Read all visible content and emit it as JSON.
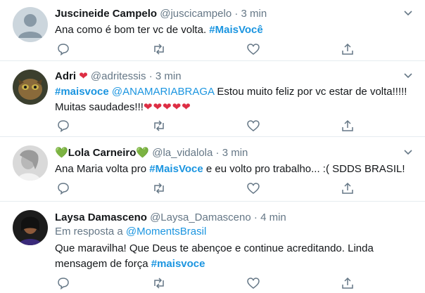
{
  "tweets": [
    {
      "name": "Juscineide Campelo",
      "handle": "@juscicampelo",
      "sep": "·",
      "time": "3 min",
      "text": "Ana como é bom ter vc de volta.",
      "hashtag": "#MaisVocê"
    },
    {
      "name": "Adri",
      "name_emoji": "❤",
      "handle": "@adritessis",
      "sep": "·",
      "time": "3 min",
      "hashtag": "#maisvoce",
      "mention": "@ANAMARIABRAGA",
      "text": "Estou muito feliz por vc estar de volta!!!!! Muitas saudades!!!",
      "hearts": "❤❤❤❤❤"
    },
    {
      "name_prefix": "💚",
      "name": "Lola Carneiro",
      "name_suffix": "💚",
      "handle": "@la_vidalola",
      "sep": "·",
      "time": "3 min",
      "text_before": "Ana Maria volta pro",
      "hashtag": "#MaisVoce",
      "text_after": "e eu volto pro trabalho... :( SDDS BRASIL!"
    },
    {
      "name": "Laysa Damasceno",
      "handle": "@Laysa_Damasceno",
      "sep": "·",
      "time": "4 min",
      "reply_label": "Em resposta a",
      "reply_to": "@MomentsBrasil",
      "text": "Que maravilha! Que Deus te abençoe e continue acreditando. Linda mensagem de força",
      "hashtag": "#maisvoce"
    }
  ],
  "colors": {
    "text": "#14171a",
    "muted": "#657786",
    "link": "#1b95e0",
    "heart": "#dd2e44",
    "green_heart": "#78b159",
    "divider": "#e6ecf0"
  },
  "icons": [
    "reply-icon",
    "retweet-icon",
    "like-icon",
    "share-icon",
    "caret-down-icon"
  ]
}
